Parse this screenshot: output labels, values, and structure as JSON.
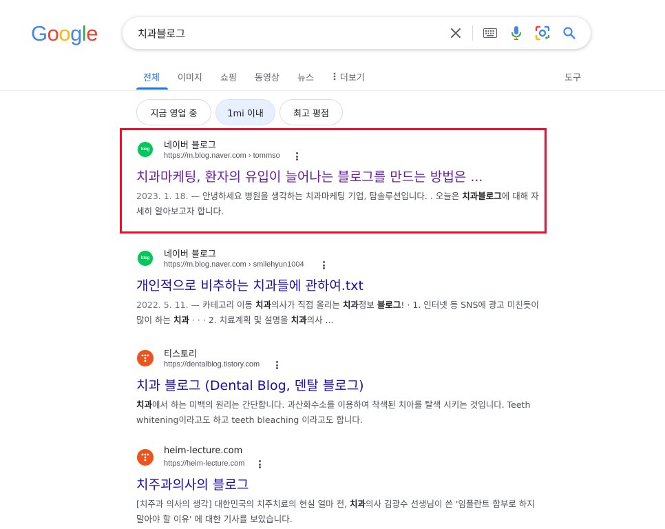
{
  "logo": [
    "G",
    "o",
    "o",
    "g",
    "l",
    "e"
  ],
  "search": {
    "query": "치과블로그"
  },
  "icons": {
    "clear": "close-icon",
    "keyboard": "keyboard-icon",
    "voice": "mic-icon",
    "lens": "lens-icon",
    "search": "search-icon"
  },
  "tabs": [
    {
      "label": "전체",
      "active": true
    },
    {
      "label": "이미지"
    },
    {
      "label": "쇼핑"
    },
    {
      "label": "동영상"
    },
    {
      "label": "뉴스"
    },
    {
      "label": "더보기"
    }
  ],
  "tools_label": "도구",
  "chips": [
    {
      "label": "지금 영업 중"
    },
    {
      "label": "1mi 이내",
      "selected": true
    },
    {
      "label": "최고 평점"
    }
  ],
  "results": [
    {
      "site": "네이버 블로그",
      "url": "https://m.blog.naver.com › tommso",
      "favicon": "blog",
      "favicon_text": "blog",
      "title": "치과마케팅, 환자의 유입이 늘어나는 블로그를 만드는 방법은 ...",
      "visited": true,
      "snippet_date": "2023. 1. 18. — ",
      "snippet_parts": [
        {
          "t": "안녕하세요 병원을 생각하는 치과마케팅 기업, 탐솔루션입니다. . 오늘은 "
        },
        {
          "t": "치과블로그",
          "b": true
        },
        {
          "t": "에 대해 자세히 알아보고자 합니다."
        }
      ]
    },
    {
      "site": "네이버 블로그",
      "url": "https://m.blog.naver.com › smilehyun1004",
      "favicon": "blog",
      "favicon_text": "blog",
      "title": "개인적으로 비추하는 치과들에 관하여.txt",
      "visited": false,
      "snippet_date": "2022. 5. 11. — ",
      "snippet_parts": [
        {
          "t": "카테고리 이동 "
        },
        {
          "t": "치과",
          "b": true
        },
        {
          "t": "의사가 직접 올리는 "
        },
        {
          "t": "치과",
          "b": true
        },
        {
          "t": "정보 "
        },
        {
          "t": "블로그",
          "b": true
        },
        {
          "t": "! · 1. 인터넷 등 SNS에 광고 미친듯이 많이 하는 "
        },
        {
          "t": "치과",
          "b": true
        },
        {
          "t": " · · · 2. 치료계획 및 설명을 "
        },
        {
          "t": "치과",
          "b": true
        },
        {
          "t": "의사 ..."
        }
      ]
    },
    {
      "site": "티스토리",
      "url": "https://dentalblog.tistory.com",
      "favicon": "tistory",
      "title": "치과 블로그 (Dental Blog, 덴탈 블로그)",
      "visited": false,
      "snippet_date": "",
      "snippet_parts": [
        {
          "t": "치과",
          "b": true
        },
        {
          "t": "에서 하는 미백의 원리는 간단합니다. 과산화수소를 이용하여 착색된 치아를 탈색 시키는 것입니다. Teeth whitening이라고도 하고 teeth bleaching 이라고도 합니다."
        }
      ]
    },
    {
      "site": "heim-lecture.com",
      "url": "https://heim-lecture.com",
      "favicon": "tistory",
      "title": "치주과의사의 블로그",
      "visited": false,
      "snippet_date": "",
      "snippet_parts": [
        {
          "t": "[치주과 의사의 생각] 대한민국의 치주치료의 현실 얼마 전, "
        },
        {
          "t": "치과",
          "b": true
        },
        {
          "t": "의사 김광수 선생님이 쓴 '임플란트 함부로 하지 말아야 할 이유' 에 대한 기사를 보았습니다."
        }
      ]
    }
  ],
  "colors": {
    "link": "#1a0dab",
    "visited": "#681da8",
    "accent": "#1a73e8",
    "highlight": "#e8112d"
  }
}
